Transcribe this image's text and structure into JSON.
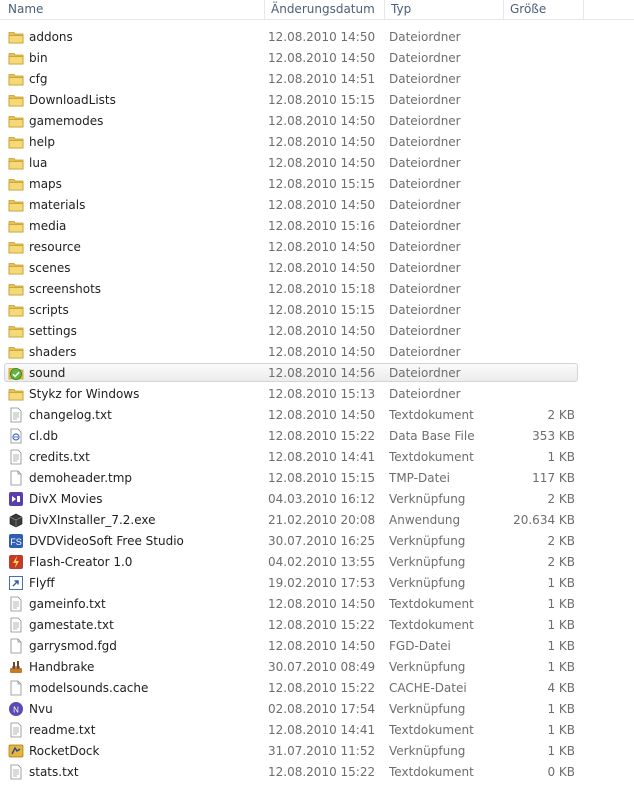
{
  "columns": {
    "name": "Name",
    "date": "Änderungsdatum",
    "type": "Typ",
    "size": "Größe"
  },
  "selected_index": 16,
  "files": [
    {
      "name": "addons",
      "date": "12.08.2010 14:50",
      "type": "Dateiordner",
      "size": "",
      "icon": "folder-icon"
    },
    {
      "name": "bin",
      "date": "12.08.2010 14:50",
      "type": "Dateiordner",
      "size": "",
      "icon": "folder-icon"
    },
    {
      "name": "cfg",
      "date": "12.08.2010 14:51",
      "type": "Dateiordner",
      "size": "",
      "icon": "folder-icon"
    },
    {
      "name": "DownloadLists",
      "date": "12.08.2010 15:15",
      "type": "Dateiordner",
      "size": "",
      "icon": "folder-icon"
    },
    {
      "name": "gamemodes",
      "date": "12.08.2010 14:50",
      "type": "Dateiordner",
      "size": "",
      "icon": "folder-icon"
    },
    {
      "name": "help",
      "date": "12.08.2010 14:50",
      "type": "Dateiordner",
      "size": "",
      "icon": "folder-icon"
    },
    {
      "name": "lua",
      "date": "12.08.2010 14:50",
      "type": "Dateiordner",
      "size": "",
      "icon": "folder-icon"
    },
    {
      "name": "maps",
      "date": "12.08.2010 15:15",
      "type": "Dateiordner",
      "size": "",
      "icon": "folder-icon"
    },
    {
      "name": "materials",
      "date": "12.08.2010 14:50",
      "type": "Dateiordner",
      "size": "",
      "icon": "folder-icon"
    },
    {
      "name": "media",
      "date": "12.08.2010 15:16",
      "type": "Dateiordner",
      "size": "",
      "icon": "folder-icon"
    },
    {
      "name": "resource",
      "date": "12.08.2010 14:50",
      "type": "Dateiordner",
      "size": "",
      "icon": "folder-icon"
    },
    {
      "name": "scenes",
      "date": "12.08.2010 14:50",
      "type": "Dateiordner",
      "size": "",
      "icon": "folder-icon"
    },
    {
      "name": "screenshots",
      "date": "12.08.2010 15:18",
      "type": "Dateiordner",
      "size": "",
      "icon": "folder-icon"
    },
    {
      "name": "scripts",
      "date": "12.08.2010 15:15",
      "type": "Dateiordner",
      "size": "",
      "icon": "folder-icon"
    },
    {
      "name": "settings",
      "date": "12.08.2010 14:50",
      "type": "Dateiordner",
      "size": "",
      "icon": "folder-icon"
    },
    {
      "name": "shaders",
      "date": "12.08.2010 14:50",
      "type": "Dateiordner",
      "size": "",
      "icon": "folder-icon"
    },
    {
      "name": "sound",
      "date": "12.08.2010 14:56",
      "type": "Dateiordner",
      "size": "",
      "icon": "sound-folder-icon"
    },
    {
      "name": "Stykz for Windows",
      "date": "12.08.2010 15:13",
      "type": "Dateiordner",
      "size": "",
      "icon": "folder-icon"
    },
    {
      "name": "changelog.txt",
      "date": "12.08.2010 14:50",
      "type": "Textdokument",
      "size": "2 KB",
      "icon": "text-document-icon"
    },
    {
      "name": "cl.db",
      "date": "12.08.2010 15:22",
      "type": "Data Base File",
      "size": "353 KB",
      "icon": "database-file-icon"
    },
    {
      "name": "credits.txt",
      "date": "12.08.2010 14:41",
      "type": "Textdokument",
      "size": "1 KB",
      "icon": "text-document-icon"
    },
    {
      "name": "demoheader.tmp",
      "date": "12.08.2010 15:15",
      "type": "TMP-Datei",
      "size": "117 KB",
      "icon": "blank-file-icon"
    },
    {
      "name": "DivX Movies",
      "date": "04.03.2010 16:12",
      "type": "Verknüpfung",
      "size": "2 KB",
      "icon": "divx-movies-icon"
    },
    {
      "name": "DivXInstaller_7.2.exe",
      "date": "21.02.2010 20:08",
      "type": "Anwendung",
      "size": "20.634 KB",
      "icon": "divx-installer-icon"
    },
    {
      "name": "DVDVideoSoft Free Studio",
      "date": "30.07.2010 16:25",
      "type": "Verknüpfung",
      "size": "2 KB",
      "icon": "dvdvideosoft-icon"
    },
    {
      "name": "Flash-Creator 1.0",
      "date": "04.02.2010 13:55",
      "type": "Verknüpfung",
      "size": "2 KB",
      "icon": "flash-creator-icon"
    },
    {
      "name": "Flyff",
      "date": "19.02.2010 17:53",
      "type": "Verknüpfung",
      "size": "1 KB",
      "icon": "shortcut-icon"
    },
    {
      "name": "gameinfo.txt",
      "date": "12.08.2010 14:50",
      "type": "Textdokument",
      "size": "1 KB",
      "icon": "text-document-icon"
    },
    {
      "name": "gamestate.txt",
      "date": "12.08.2010 15:22",
      "type": "Textdokument",
      "size": "1 KB",
      "icon": "text-document-icon"
    },
    {
      "name": "garrysmod.fgd",
      "date": "12.08.2010 14:50",
      "type": "FGD-Datei",
      "size": "1 KB",
      "icon": "blank-file-icon"
    },
    {
      "name": "Handbrake",
      "date": "30.07.2010 08:49",
      "type": "Verknüpfung",
      "size": "1 KB",
      "icon": "handbrake-icon"
    },
    {
      "name": "modelsounds.cache",
      "date": "12.08.2010 15:22",
      "type": "CACHE-Datei",
      "size": "4 KB",
      "icon": "blank-file-icon"
    },
    {
      "name": "Nvu",
      "date": "02.08.2010 17:54",
      "type": "Verknüpfung",
      "size": "1 KB",
      "icon": "nvu-icon"
    },
    {
      "name": "readme.txt",
      "date": "12.08.2010 14:41",
      "type": "Textdokument",
      "size": "1 KB",
      "icon": "text-document-icon"
    },
    {
      "name": "RocketDock",
      "date": "31.07.2010 11:52",
      "type": "Verknüpfung",
      "size": "1 KB",
      "icon": "rocketdock-icon"
    },
    {
      "name": "stats.txt",
      "date": "12.08.2010 15:22",
      "type": "Textdokument",
      "size": "0 KB",
      "icon": "text-document-icon"
    }
  ]
}
